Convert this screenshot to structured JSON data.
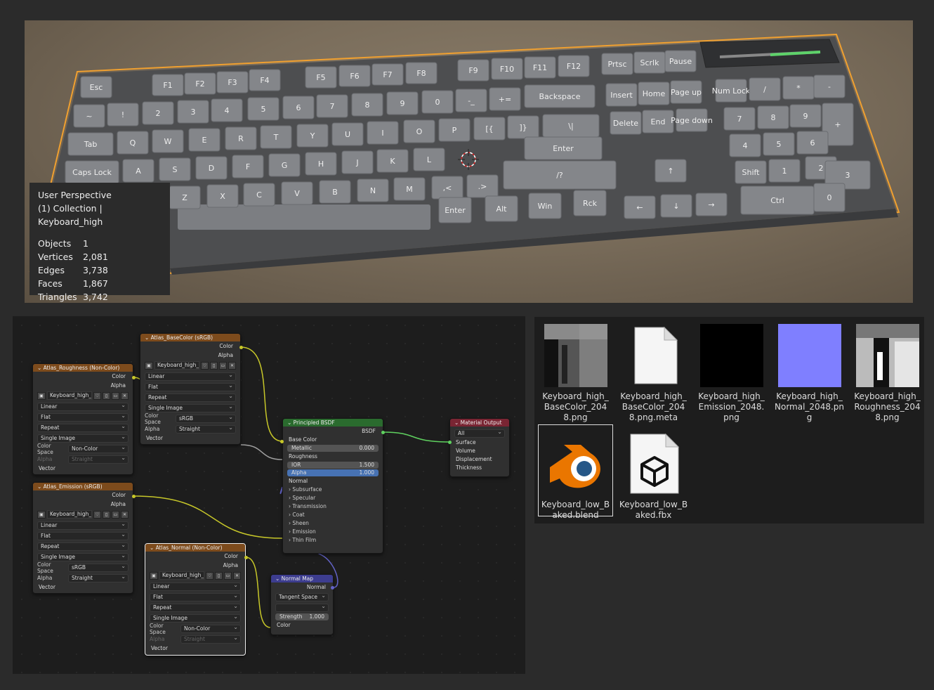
{
  "viewport": {
    "overlay": {
      "view": "User Perspective",
      "collection": "(1) Collection | Keyboard_high",
      "stats": [
        {
          "label": "Objects",
          "value": "1"
        },
        {
          "label": "Vertices",
          "value": "2,081"
        },
        {
          "label": "Edges",
          "value": "3,738"
        },
        {
          "label": "Faces",
          "value": "1,867"
        },
        {
          "label": "Triangles",
          "value": "3,742"
        }
      ]
    },
    "selection_color": "#f0a030",
    "keys": [
      "Esc",
      "F1",
      "F2",
      "F3",
      "F4",
      "F5",
      "F6",
      "F7",
      "F8",
      "F9",
      "F10",
      "F11",
      "F12",
      "Prtsc",
      "Scrlk",
      "Pause",
      "~",
      "!",
      "2",
      "3",
      "4",
      "5",
      "6",
      "7",
      "8",
      "9",
      "0",
      "-_",
      "+=",
      "Backspace",
      "Insert",
      "Home",
      "Page up",
      "Num Lock",
      "/",
      "*",
      "-",
      "Tab",
      "Q",
      "W",
      "E",
      "R",
      "T",
      "Y",
      "U",
      "I",
      "O",
      "P",
      "[{",
      "]}",
      "\\|",
      "Delete",
      "End",
      "Page down",
      "7",
      "8",
      "9",
      "+",
      "Caps Lock",
      "A",
      "S",
      "D",
      "F",
      "G",
      "H",
      "J",
      "K",
      "L",
      "Enter",
      "4",
      "5",
      "6",
      "Z",
      "X",
      "C",
      "V",
      "B",
      "N",
      "M",
      ",<",
      ".>",
      "/?",
      "Shift",
      "1",
      "2",
      "3",
      "Enter",
      "Alt",
      "Win",
      "Rck",
      "Ctrl",
      "0",
      "."
    ]
  },
  "node_editor": {
    "nodes": {
      "roughness": {
        "title": "Atlas_Roughness (Non-Color)",
        "outputs": [
          "Color",
          "Alpha"
        ],
        "image": "Keyboard_high_...",
        "interpolation": "Linear",
        "projection": "Flat",
        "extension": "Repeat",
        "source": "Single Image",
        "color_space_label": "Color Space",
        "color_space": "Non-Color",
        "alpha_label": "Alpha",
        "alpha_mode": "Straight",
        "input": "Vector"
      },
      "basecolor": {
        "title": "Atlas_BaseColor (sRGB)",
        "outputs": [
          "Color",
          "Alpha"
        ],
        "image": "Keyboard_high_...",
        "interpolation": "Linear",
        "projection": "Flat",
        "extension": "Repeat",
        "source": "Single Image",
        "color_space_label": "Color Space",
        "color_space": "sRGB",
        "alpha_label": "Alpha",
        "alpha_mode": "Straight",
        "input": "Vector"
      },
      "emission": {
        "title": "Atlas_Emission (sRGB)",
        "outputs": [
          "Color",
          "Alpha"
        ],
        "image": "Keyboard_high_...",
        "interpolation": "Linear",
        "projection": "Flat",
        "extension": "Repeat",
        "source": "Single Image",
        "color_space_label": "Color Space",
        "color_space": "sRGB",
        "alpha_label": "Alpha",
        "alpha_mode": "Straight",
        "input": "Vector"
      },
      "normal_tex": {
        "title": "Atlas_Normal (Non-Color)",
        "outputs": [
          "Color",
          "Alpha"
        ],
        "image": "Keyboard_high_...",
        "interpolation": "Linear",
        "projection": "Flat",
        "extension": "Repeat",
        "source": "Single Image",
        "color_space_label": "Color Space",
        "color_space": "Non-Color",
        "alpha_label": "Alpha",
        "alpha_mode": "Straight",
        "input": "Vector"
      },
      "bsdf": {
        "title": "Principled BSDF",
        "output": "BSDF",
        "base_color": "Base Color",
        "metallic_label": "Metallic",
        "metallic": "0.000",
        "roughness": "Roughness",
        "ior_label": "IOR",
        "ior": "1.500",
        "alpha_label": "Alpha",
        "alpha": "1.000",
        "normal": "Normal",
        "panels": [
          "Subsurface",
          "Specular",
          "Transmission",
          "Coat",
          "Sheen",
          "Emission",
          "Thin Film"
        ]
      },
      "output": {
        "title": "Material Output",
        "target": "All",
        "inputs": [
          "Surface",
          "Volume",
          "Displacement",
          "Thickness"
        ]
      },
      "normal_map": {
        "title": "Normal Map",
        "output": "Normal",
        "space": "Tangent Space",
        "strength_label": "Strength",
        "strength": "1.000",
        "input": "Color"
      }
    }
  },
  "file_browser": {
    "files": [
      {
        "name": "Keyboard_high_BaseColor_2048.png",
        "icon": "basecolor-thumbnail"
      },
      {
        "name": "Keyboard_high_BaseColor_2048.png.meta",
        "icon": "blank-file-icon"
      },
      {
        "name": "Keyboard_high_Emission_2048.png",
        "icon": "emission-thumbnail"
      },
      {
        "name": "Keyboard_high_Normal_2048.png",
        "icon": "normal-thumbnail"
      },
      {
        "name": "Keyboard_high_Roughness_2048.png",
        "icon": "roughness-thumbnail"
      },
      {
        "name": "Keyboard_low_Baked.blend",
        "icon": "blender-logo-icon"
      },
      {
        "name": "Keyboard_low_Baked.fbx",
        "icon": "3d-object-file-icon"
      }
    ]
  }
}
